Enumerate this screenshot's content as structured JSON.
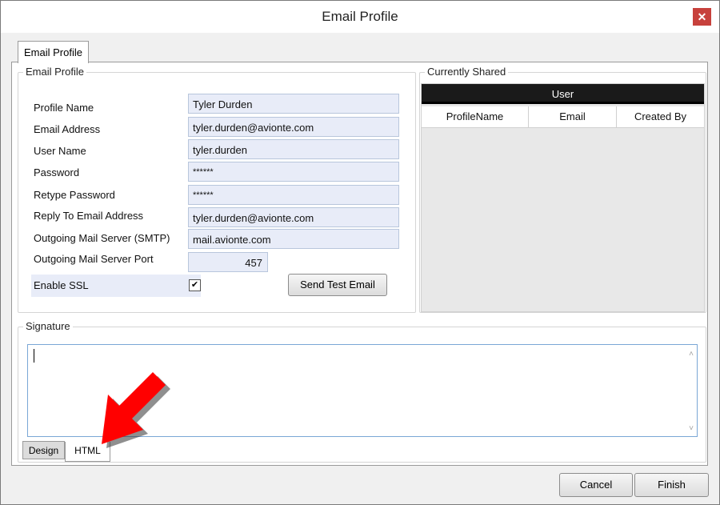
{
  "window": {
    "title": "Email Profile",
    "close_glyph": "✕"
  },
  "tabs": {
    "main_tab": "Email Profile"
  },
  "profile_group": {
    "legend": "Email Profile",
    "fields": [
      {
        "label": "Profile Name",
        "value": "Tyler Durden"
      },
      {
        "label": "Email Address",
        "value": "tyler.durden@avionte.com"
      },
      {
        "label": "User Name",
        "value": "tyler.durden"
      },
      {
        "label": "Password",
        "value": "******"
      },
      {
        "label": "Retype Password",
        "value": "******"
      },
      {
        "label": "Reply To Email Address",
        "value": "tyler.durden@avionte.com"
      },
      {
        "label": "Outgoing Mail Server (SMTP)",
        "value": "mail.avionte.com"
      },
      {
        "label": "Outgoing Mail Server Port",
        "value": "457"
      }
    ],
    "ssl": {
      "label": "Enable SSL",
      "checked": true,
      "check_glyph": "✔"
    },
    "test_button": "Send Test Email"
  },
  "shared_group": {
    "legend": "Currently Shared",
    "band": "User",
    "columns": [
      "ProfileName",
      "Email",
      "Created By"
    ]
  },
  "signature": {
    "legend": "Signature",
    "tabs": [
      "Design",
      "HTML"
    ],
    "scroll_up": "˄",
    "scroll_down": "˅"
  },
  "footer": {
    "cancel": "Cancel",
    "finish": "Finish"
  },
  "colors": {
    "field_bg": "#e8ecf8",
    "close_bg": "#c7413c",
    "annotation_arrow": "#ff0000"
  },
  "annotation": {
    "icon": "red-arrow-icon"
  }
}
